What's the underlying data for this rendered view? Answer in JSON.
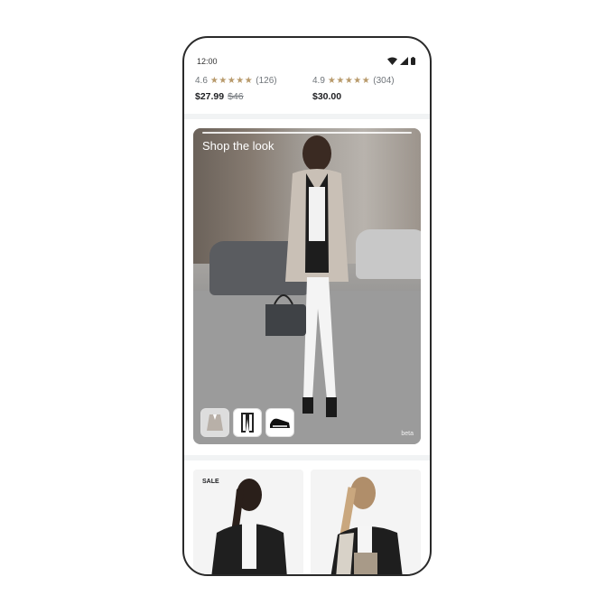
{
  "status": {
    "time": "12:00"
  },
  "products_top": [
    {
      "rating": "4.6",
      "stars": "★★★★★",
      "reviews": "(126)",
      "price": "$27.99",
      "old_price": "$46"
    },
    {
      "rating": "4.9",
      "stars": "★★★★★",
      "reviews": "(304)",
      "price": "$30.00"
    }
  ],
  "shop_the_look": {
    "title": "Shop the look",
    "beta_label": "beta"
  },
  "products_bottom": [
    {
      "badge": "SALE"
    },
    {
      "badge": ""
    }
  ]
}
